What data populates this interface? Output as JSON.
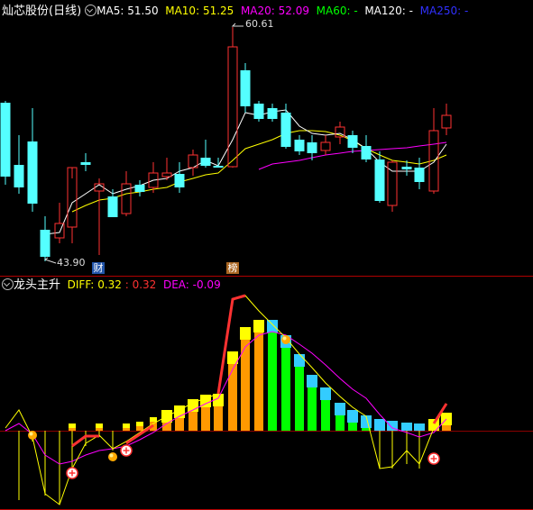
{
  "header": {
    "title": "灿芯股份(日线)",
    "ma5_label": "MA5:",
    "ma5_value": "51.50",
    "ma10_label": "MA10:",
    "ma10_value": "51.25",
    "ma20_label": "MA20:",
    "ma20_value": "52.09",
    "ma60_label": "MA60:",
    "ma60_value": "-",
    "ma120_label": "MA120:",
    "ma120_value": "-",
    "ma250_label": "MA250:",
    "ma250_value": "-"
  },
  "price_panel": {
    "high_label": "60.61",
    "low_label": "43.90",
    "marker_cai": "财",
    "marker_bang": "榜"
  },
  "indicator": {
    "title": "龙头主升",
    "diff_label": "DIFF:",
    "diff_value": "0.32",
    "sep_value": ": 0.32",
    "dea_label": "DEA:",
    "dea_value": "-0.09"
  },
  "colors": {
    "up": "#ff3232",
    "down": "#54ffff",
    "ma5": "#ffffff",
    "ma10": "#ffff00",
    "ma20": "#ff00ff",
    "ma60": "#00ff00",
    "ma120": "#ffffff",
    "ma250": "#3030ff",
    "diff": "#ffff00",
    "dea": "#ff00ff",
    "bar_orange": "#ff9900",
    "bar_green": "#00ff00",
    "bar_cap_yellow": "#ffff00",
    "bar_cap_cyan": "#33ccff"
  }
}
